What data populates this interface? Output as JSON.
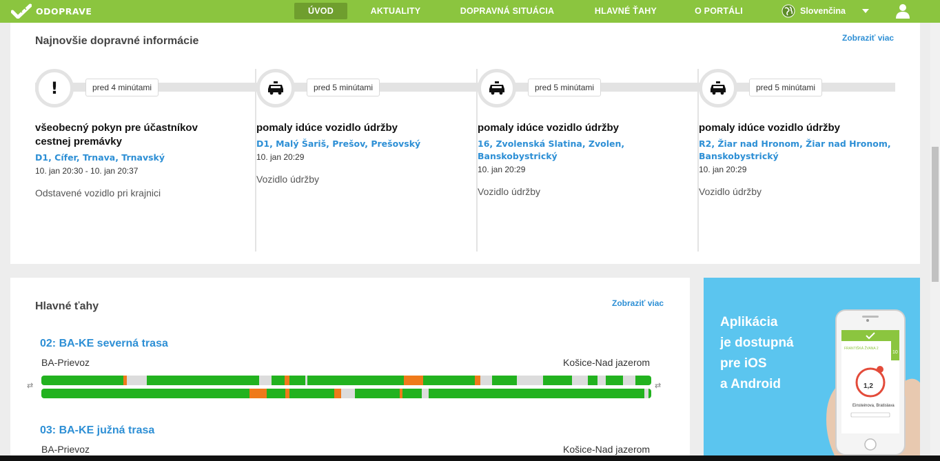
{
  "nav": {
    "logo_text": "ODOPRAVE",
    "items": [
      {
        "label": "ÚVOD"
      },
      {
        "label": "AKTUALITY"
      },
      {
        "label": "DOPRAVNÁ SITUÁCIA"
      },
      {
        "label": "HLAVNÉ ŤAHY"
      },
      {
        "label": "O PORTÁLI"
      }
    ],
    "language": "Slovenčina"
  },
  "news": {
    "title": "Najnovšie dopravné informácie",
    "more_label": "Zobraziť viac",
    "items": [
      {
        "icon": "exclamation-icon",
        "time": "pred 4 minútami",
        "title": "všeobecný pokyn pre účastníkov cestnej premávky",
        "road": "D1, Cífer, Trnava, Trnavský",
        "date": "10. jan 20:30 - 10. jan 20:37",
        "desc": "Odstavené vozidlo pri krajnici"
      },
      {
        "icon": "maintenance-vehicle-icon",
        "time": "pred 5 minútami",
        "title": "pomaly idúce vozidlo údržby",
        "road": "D1, Malý Šariš, Prešov, Prešovský",
        "date": "10. jan 20:29",
        "desc": "Vozidlo údržby"
      },
      {
        "icon": "maintenance-vehicle-icon",
        "time": "pred 5 minútami",
        "title": "pomaly idúce vozidlo údržby",
        "road": "16, Zvolenská Slatina, Zvolen, Banskobystrický",
        "date": "10. jan 20:29",
        "desc": "Vozidlo údržby"
      },
      {
        "icon": "maintenance-vehicle-icon",
        "time": "pred 5 minútami",
        "title": "pomaly idúce vozidlo údržby",
        "road": "R2, Žiar nad Hronom, Žiar nad Hronom, Banskobystrický",
        "date": "10. jan 20:29",
        "desc": "Vozidlo údržby"
      }
    ]
  },
  "routes": {
    "title": "Hlavné ťahy",
    "more_label": "Zobraziť viac",
    "colors": {
      "free": "#22b21f",
      "slow": "#ef7a1a",
      "none": "#dcdcdc"
    },
    "items": [
      {
        "name": "02: BA-KE severná trasa",
        "from": "BA-Prievoz",
        "to": "Košice-Nad jazerom",
        "lanes": [
          [
            [
              "free",
              118
            ],
            [
              "slow",
              5
            ],
            [
              "none",
              29
            ],
            [
              "free",
              162
            ],
            [
              "none",
              18
            ],
            [
              "free",
              19
            ],
            [
              "slow",
              7
            ],
            [
              "free",
              23
            ],
            [
              "none",
              3
            ],
            [
              "free",
              139
            ],
            [
              "slow",
              28
            ],
            [
              "free",
              75
            ],
            [
              "slow",
              8
            ],
            [
              "none",
              16
            ],
            [
              "free",
              36
            ],
            [
              "none",
              38
            ],
            [
              "free",
              42
            ],
            [
              "none",
              23
            ],
            [
              "free",
              14
            ],
            [
              "none",
              12
            ],
            [
              "free",
              24
            ],
            [
              "none",
              18
            ],
            [
              "free",
              23
            ]
          ],
          [
            [
              "free",
              299
            ],
            [
              "slow",
              25
            ],
            [
              "free",
              27
            ],
            [
              "slow",
              6
            ],
            [
              "free",
              64
            ],
            [
              "slow",
              10
            ],
            [
              "none",
              20
            ],
            [
              "free",
              64
            ],
            [
              "slow",
              4
            ],
            [
              "free",
              28
            ],
            [
              "none",
              10
            ],
            [
              "free",
              310
            ],
            [
              "none",
              6
            ],
            [
              "free",
              4
            ]
          ]
        ]
      },
      {
        "name": "03: BA-KE južná trasa",
        "from": "BA-Prievoz",
        "to": "Košice-Nad jazerom"
      }
    ]
  },
  "ad": {
    "lines": [
      "Aplikácia",
      "je dostupná",
      "pre iOS",
      "a Android"
    ],
    "phone_label_street": "FRANTIŠKÁ ŽVANA 2",
    "phone_speed": "10",
    "phone_distance": "1,2",
    "phone_place": "Einsteinova, Bratislava"
  }
}
